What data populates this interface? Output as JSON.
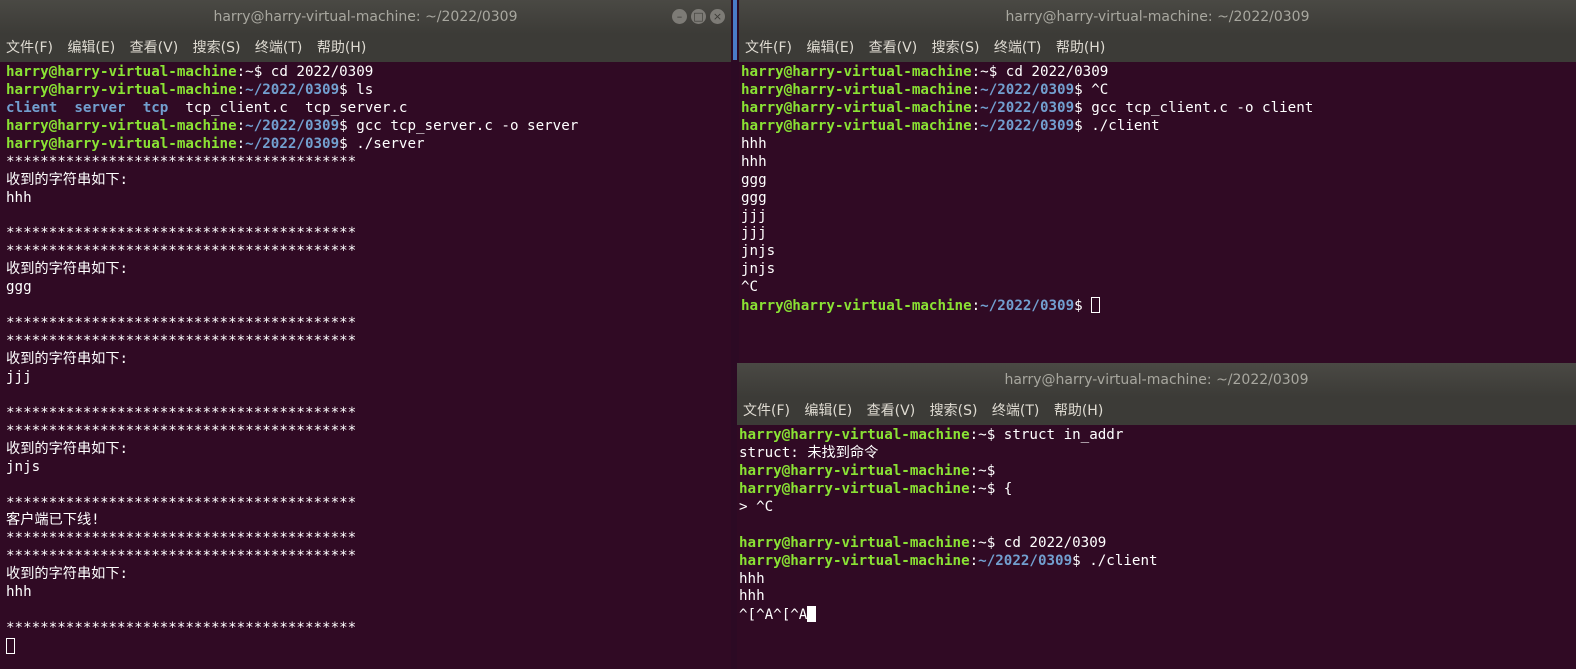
{
  "menu": [
    "文件(F)",
    "编辑(E)",
    "查看(V)",
    "搜索(S)",
    "终端(T)",
    "帮助(H)"
  ],
  "left": {
    "title": "harry@harry-virtual-machine: ~/2022/0309",
    "lines": [
      [
        {
          "c": "ug",
          "t": "harry@harry-virtual-machine"
        },
        {
          "t": ":~$ cd 2022/0309"
        }
      ],
      [
        {
          "c": "ug",
          "t": "harry@harry-virtual-machine"
        },
        {
          "t": ":"
        },
        {
          "c": "pb",
          "t": "~/2022/0309"
        },
        {
          "t": "$ ls"
        }
      ],
      [
        {
          "c": "dir",
          "t": "client"
        },
        {
          "t": "  "
        },
        {
          "c": "dir",
          "t": "server"
        },
        {
          "t": "  "
        },
        {
          "c": "dir",
          "t": "tcp"
        },
        {
          "t": "  tcp_client.c  tcp_server.c"
        }
      ],
      [
        {
          "c": "ug",
          "t": "harry@harry-virtual-machine"
        },
        {
          "t": ":"
        },
        {
          "c": "pb",
          "t": "~/2022/0309"
        },
        {
          "t": "$ gcc tcp_server.c -o server"
        }
      ],
      [
        {
          "c": "ug",
          "t": "harry@harry-virtual-machine"
        },
        {
          "t": ":"
        },
        {
          "c": "pb",
          "t": "~/2022/0309"
        },
        {
          "t": "$ ./server"
        }
      ],
      [
        {
          "t": "*****************************************"
        }
      ],
      [
        {
          "t": "收到的字符串如下:"
        }
      ],
      [
        {
          "t": "hhh"
        }
      ],
      [
        {
          "t": ""
        }
      ],
      [
        {
          "t": "*****************************************"
        }
      ],
      [
        {
          "t": "*****************************************"
        }
      ],
      [
        {
          "t": "收到的字符串如下:"
        }
      ],
      [
        {
          "t": "ggg"
        }
      ],
      [
        {
          "t": ""
        }
      ],
      [
        {
          "t": "*****************************************"
        }
      ],
      [
        {
          "t": "*****************************************"
        }
      ],
      [
        {
          "t": "收到的字符串如下:"
        }
      ],
      [
        {
          "t": "jjj"
        }
      ],
      [
        {
          "t": ""
        }
      ],
      [
        {
          "t": "*****************************************"
        }
      ],
      [
        {
          "t": "*****************************************"
        }
      ],
      [
        {
          "t": "收到的字符串如下:"
        }
      ],
      [
        {
          "t": "jnjs"
        }
      ],
      [
        {
          "t": ""
        }
      ],
      [
        {
          "t": "*****************************************"
        }
      ],
      [
        {
          "t": "客户端已下线!"
        }
      ],
      [
        {
          "t": "*****************************************"
        }
      ],
      [
        {
          "t": "*****************************************"
        }
      ],
      [
        {
          "t": "收到的字符串如下:"
        }
      ],
      [
        {
          "t": "hhh"
        }
      ],
      [
        {
          "t": ""
        }
      ],
      [
        {
          "t": "*****************************************"
        }
      ],
      [
        {
          "cursor": "hollow"
        }
      ]
    ]
  },
  "right_top": {
    "title": "harry@harry-virtual-machine: ~/2022/0309",
    "lines": [
      [
        {
          "c": "ug",
          "t": "harry@harry-virtual-machine"
        },
        {
          "t": ":~$ cd 2022/0309"
        }
      ],
      [
        {
          "c": "ug",
          "t": "harry@harry-virtual-machine"
        },
        {
          "t": ":"
        },
        {
          "c": "pb",
          "t": "~/2022/0309"
        },
        {
          "t": "$ ^C"
        }
      ],
      [
        {
          "c": "ug",
          "t": "harry@harry-virtual-machine"
        },
        {
          "t": ":"
        },
        {
          "c": "pb",
          "t": "~/2022/0309"
        },
        {
          "t": "$ gcc tcp_client.c -o client"
        }
      ],
      [
        {
          "c": "ug",
          "t": "harry@harry-virtual-machine"
        },
        {
          "t": ":"
        },
        {
          "c": "pb",
          "t": "~/2022/0309"
        },
        {
          "t": "$ ./client"
        }
      ],
      [
        {
          "t": "hhh"
        }
      ],
      [
        {
          "t": "hhh"
        }
      ],
      [
        {
          "t": "ggg"
        }
      ],
      [
        {
          "t": "ggg"
        }
      ],
      [
        {
          "t": "jjj"
        }
      ],
      [
        {
          "t": "jjj"
        }
      ],
      [
        {
          "t": "jnjs"
        }
      ],
      [
        {
          "t": "jnjs"
        }
      ],
      [
        {
          "t": "^C"
        }
      ],
      [
        {
          "c": "ug",
          "t": "harry@harry-virtual-machine"
        },
        {
          "t": ":"
        },
        {
          "c": "pb",
          "t": "~/2022/0309"
        },
        {
          "t": "$ "
        },
        {
          "cursor": "hollow"
        }
      ]
    ]
  },
  "right_bottom": {
    "title": "harry@harry-virtual-machine: ~/2022/0309",
    "lines": [
      [
        {
          "c": "ug",
          "t": "harry@harry-virtual-machine"
        },
        {
          "t": ":~$ struct in_addr"
        }
      ],
      [
        {
          "t": "struct: 未找到命令"
        }
      ],
      [
        {
          "c": "ug",
          "t": "harry@harry-virtual-machine"
        },
        {
          "t": ":~$"
        }
      ],
      [
        {
          "c": "ug",
          "t": "harry@harry-virtual-machine"
        },
        {
          "t": ":~$ {"
        }
      ],
      [
        {
          "t": "> ^C"
        }
      ],
      [
        {
          "t": ""
        }
      ],
      [
        {
          "c": "ug",
          "t": "harry@harry-virtual-machine"
        },
        {
          "t": ":~$ cd 2022/0309"
        }
      ],
      [
        {
          "c": "ug",
          "t": "harry@harry-virtual-machine"
        },
        {
          "t": ":"
        },
        {
          "c": "pb",
          "t": "~/2022/0309"
        },
        {
          "t": "$ ./client"
        }
      ],
      [
        {
          "t": "hhh"
        }
      ],
      [
        {
          "t": "hhh"
        }
      ],
      [
        {
          "t": "^[^A^[^A"
        },
        {
          "cursor": "solid"
        }
      ]
    ]
  }
}
